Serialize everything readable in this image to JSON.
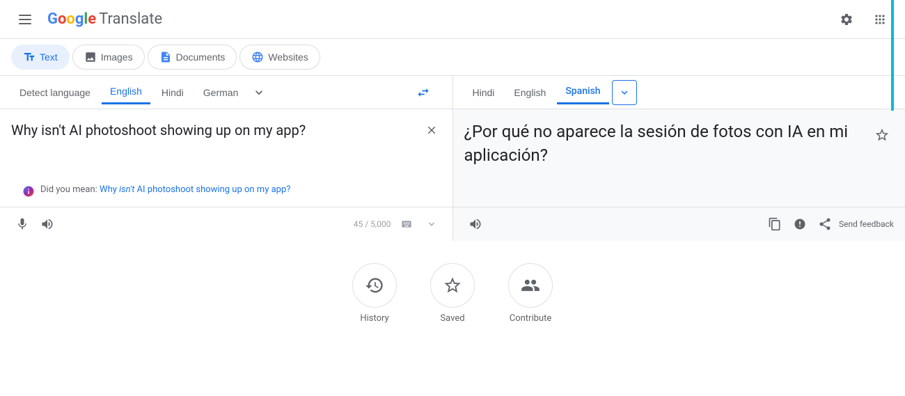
{
  "header": {
    "app_name": "Translate",
    "settings_tooltip": "Settings",
    "apps_tooltip": "Google apps"
  },
  "mode_tabs": [
    {
      "id": "text",
      "label": "Text",
      "active": true
    },
    {
      "id": "images",
      "label": "Images",
      "active": false
    },
    {
      "id": "documents",
      "label": "Documents",
      "active": false
    },
    {
      "id": "websites",
      "label": "Websites",
      "active": false
    }
  ],
  "source": {
    "languages": [
      {
        "label": "Detect language",
        "active": false
      },
      {
        "label": "English",
        "active": true
      },
      {
        "label": "Hindi",
        "active": false
      },
      {
        "label": "German",
        "active": false
      }
    ],
    "text": "Why isn't AI photoshoot showing up on my app?",
    "did_you_mean_prefix": "Did you mean: ",
    "did_you_mean_text": "Why isn't AI photoshoot showing up on my app?",
    "did_you_mean_parts": {
      "before": "Why ",
      "italic": "isn't",
      "after": " AI photoshoot showing up on my app?"
    },
    "char_count": "45 / 5,000"
  },
  "target": {
    "languages": [
      {
        "label": "Hindi",
        "active": false
      },
      {
        "label": "English",
        "active": false
      },
      {
        "label": "Spanish",
        "active": true
      }
    ],
    "text": "¿Por qué no aparece la sesión de fotos con IA en mi aplicación?",
    "send_feedback": "Send feedback"
  },
  "bottom_actions": [
    {
      "id": "history",
      "label": "History"
    },
    {
      "id": "saved",
      "label": "Saved"
    },
    {
      "id": "contribute",
      "label": "Contribute"
    }
  ]
}
